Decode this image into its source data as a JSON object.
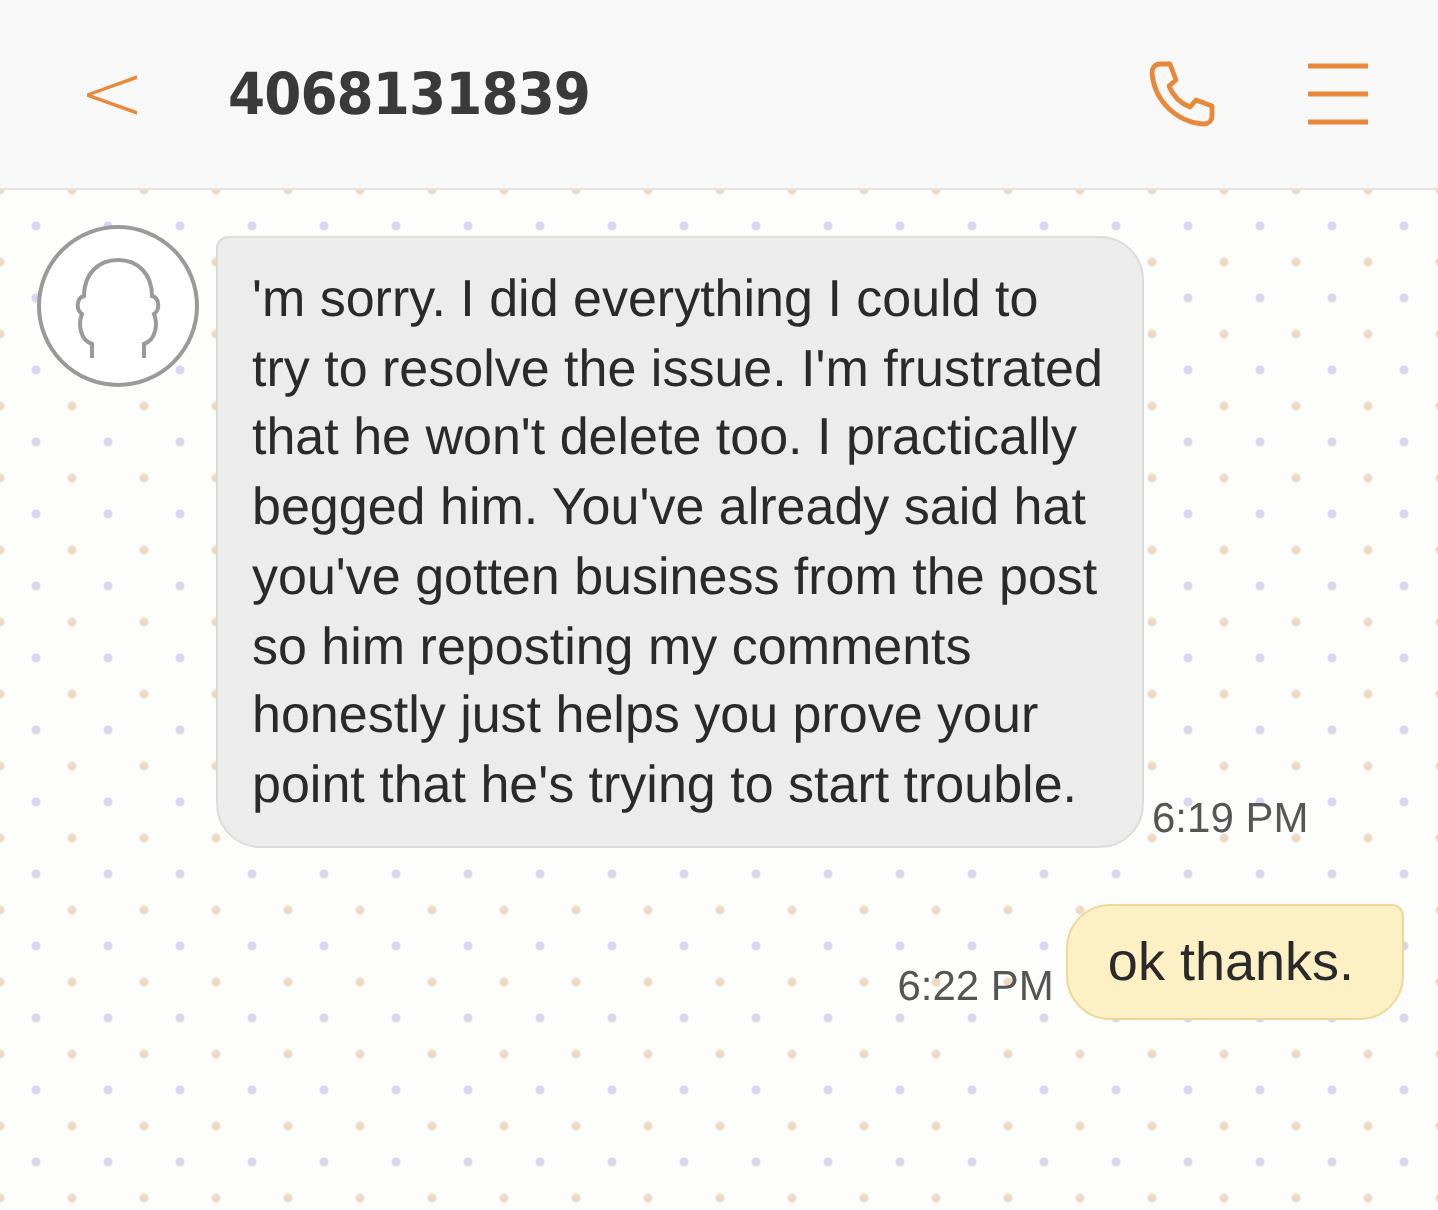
{
  "header": {
    "back": "<",
    "title": "4068131839"
  },
  "messages": [
    {
      "kind": "incoming",
      "text": "'m sorry. I did everything I could to try to resolve the issue. I'm frustrated that he won't delete too. I practically begged him. You've already said hat you've gotten business from the post so him reposting my comments honestly just helps you prove your point that he's trying to start trouble.",
      "time": "6:19 PM"
    },
    {
      "kind": "outgoing",
      "text": "ok thanks.",
      "time": "6:22 PM"
    }
  ]
}
